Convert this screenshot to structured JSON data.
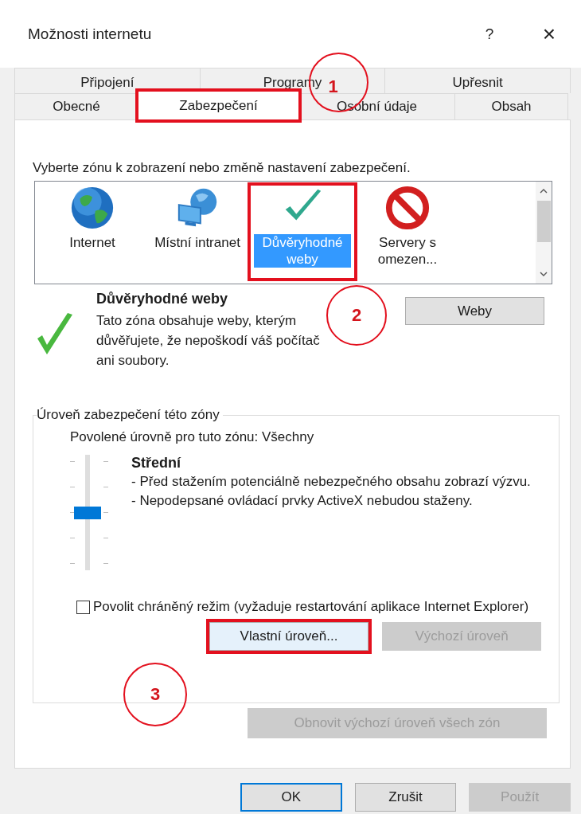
{
  "window": {
    "title": "Možnosti internetu",
    "help_button": "?",
    "close_button": "×"
  },
  "tab_rows": [
    [
      {
        "label": "Připojení",
        "selected": false,
        "highlighted": false
      },
      {
        "label": "Programy",
        "selected": false,
        "highlighted": false
      },
      {
        "label": "Upřesnit",
        "selected": false,
        "highlighted": false
      }
    ],
    [
      {
        "label": "Obecné",
        "selected": false,
        "highlighted": false
      },
      {
        "label": "Zabezpečení",
        "selected": true,
        "highlighted": true
      },
      {
        "label": "Osobní údaje",
        "selected": false,
        "highlighted": false
      },
      {
        "label": "Obsah",
        "selected": false,
        "highlighted": false
      }
    ]
  ],
  "zone_prompt": "Vyberte zónu k zobrazení nebo změně nastavení zabezpečení.",
  "zones": [
    {
      "label": "Internet",
      "kind": "globe",
      "selected": false,
      "highlighted": false
    },
    {
      "label": "Místní intranet",
      "kind": "network",
      "selected": false,
      "highlighted": false
    },
    {
      "label": "Důvěryhodné weby",
      "kind": "check",
      "selected": true,
      "highlighted": true
    },
    {
      "label": "Servery s omezen...",
      "kind": "blocked",
      "selected": false,
      "highlighted": false
    }
  ],
  "zone_details": {
    "title": "Důvěryhodné weby",
    "description": "Tato zóna obsahuje weby, kterým důvěřujete, že nepoškodí váš počítač ani soubory.",
    "sites_button": "Weby"
  },
  "security_level": {
    "legend": "Úroveň zabezpečení této zóny",
    "allowed": "Povolené úrovně pro tuto zónu: Všechny",
    "level": 0.5,
    "level_name": "Střední",
    "notes": [
      "- Před stažením potenciálně nebezpečného obsahu zobrazí výzvu.",
      "- Nepodepsané ovládací prvky ActiveX nebudou staženy."
    ],
    "protected_mode": {
      "label": "Povolit chráněný režim (vyžaduje restartování aplikace Internet Explorer)",
      "checked": false
    },
    "buttons": [
      {
        "label": "Vlastní úroveň...",
        "disabled": false,
        "highlighted": true
      },
      {
        "label": "Výchozí úroveň",
        "disabled": true,
        "highlighted": false
      }
    ]
  },
  "reset_button": {
    "label": "Obnovit výchozí úroveň všech zón",
    "disabled": true
  },
  "footer_buttons": [
    {
      "label": "OK",
      "disabled": false,
      "default": true
    },
    {
      "label": "Zrušit",
      "disabled": false,
      "default": false
    },
    {
      "label": "Použít",
      "disabled": true,
      "default": false
    }
  ],
  "annotations": [
    {
      "number": "1"
    },
    {
      "number": "2"
    },
    {
      "number": "3"
    }
  ]
}
